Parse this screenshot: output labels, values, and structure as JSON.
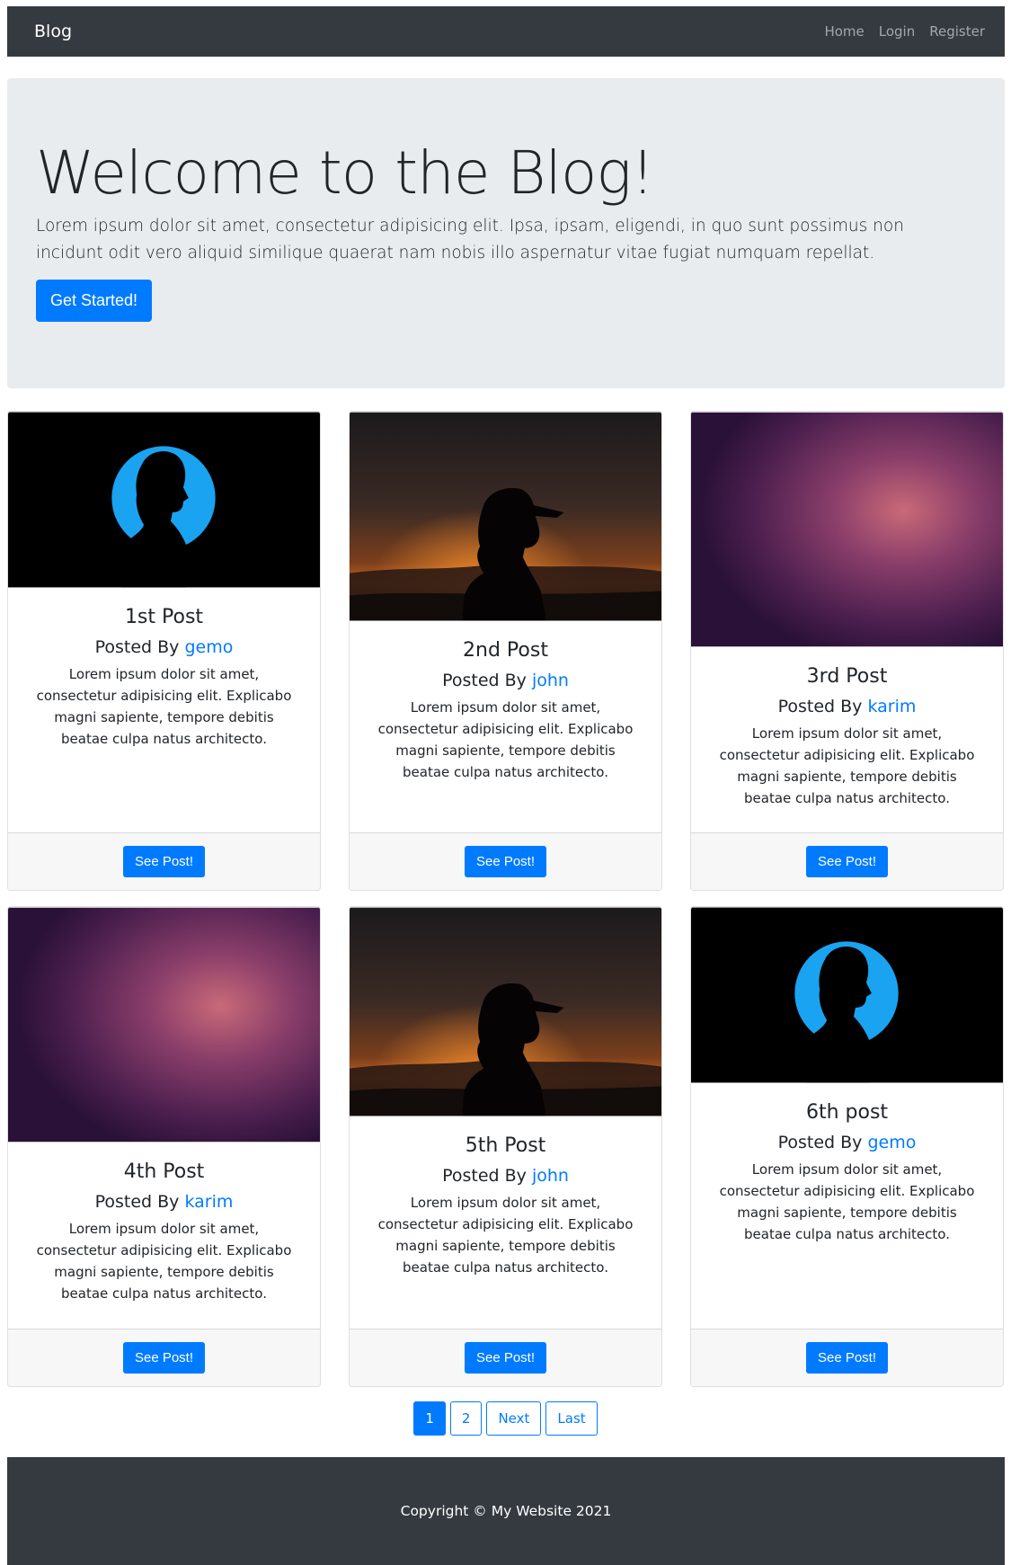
{
  "nav": {
    "brand": "Blog",
    "links": [
      "Home",
      "Login",
      "Register"
    ]
  },
  "hero": {
    "title": "Welcome to the Blog!",
    "text": "Lorem ipsum dolor sit amet, consectetur adipisicing elit. Ipsa, ipsam, eligendi, in quo sunt possimus non incidunt odit vero aliquid similique quaerat nam nobis illo aspernatur vitae fugiat numquam repellat.",
    "button": "Get Started!"
  },
  "posts": [
    {
      "title": "1st Post",
      "posted_by": "Posted By",
      "author": "gemo",
      "text": "Lorem ipsum dolor sit amet, consectetur adipisicing elit. Explicabo magni sapiente, tempore debitis beatae culpa natus architecto.",
      "button": "See Post!",
      "image": "blue-circle-silhouette"
    },
    {
      "title": "2nd Post",
      "posted_by": "Posted By",
      "author": "john",
      "text": "Lorem ipsum dolor sit amet, consectetur adipisicing elit. Explicabo magni sapiente, tempore debitis beatae culpa natus architecto.",
      "button": "See Post!",
      "image": "sunset-cap-silhouette"
    },
    {
      "title": "3rd Post",
      "posted_by": "Posted By",
      "author": "karim",
      "text": "Lorem ipsum dolor sit amet, consectetur adipisicing elit. Explicabo magni sapiente, tempore debitis beatae culpa natus architecto.",
      "button": "See Post!",
      "image": "purple-blur"
    },
    {
      "title": "4th Post",
      "posted_by": "Posted By",
      "author": "karim",
      "text": "Lorem ipsum dolor sit amet, consectetur adipisicing elit. Explicabo magni sapiente, tempore debitis beatae culpa natus architecto.",
      "button": "See Post!",
      "image": "purple-blur"
    },
    {
      "title": "5th Post",
      "posted_by": "Posted By",
      "author": "john",
      "text": "Lorem ipsum dolor sit amet, consectetur adipisicing elit. Explicabo magni sapiente, tempore debitis beatae culpa natus architecto.",
      "button": "See Post!",
      "image": "sunset-cap-silhouette"
    },
    {
      "title": "6th post",
      "posted_by": "Posted By",
      "author": "gemo",
      "text": "Lorem ipsum dolor sit amet, consectetur adipisicing elit. Explicabo magni sapiente, tempore debitis beatae culpa natus architecto.",
      "button": "See Post!",
      "image": "blue-circle-silhouette"
    }
  ],
  "pagination": {
    "pages": [
      "1",
      "2"
    ],
    "current": "1",
    "next": "Next",
    "last": "Last"
  },
  "footer": {
    "text": "Copyright © My Website 2021"
  },
  "colors": {
    "primary": "#007bff",
    "dark": "#343a40",
    "jumbotron": "#e9ecef"
  }
}
